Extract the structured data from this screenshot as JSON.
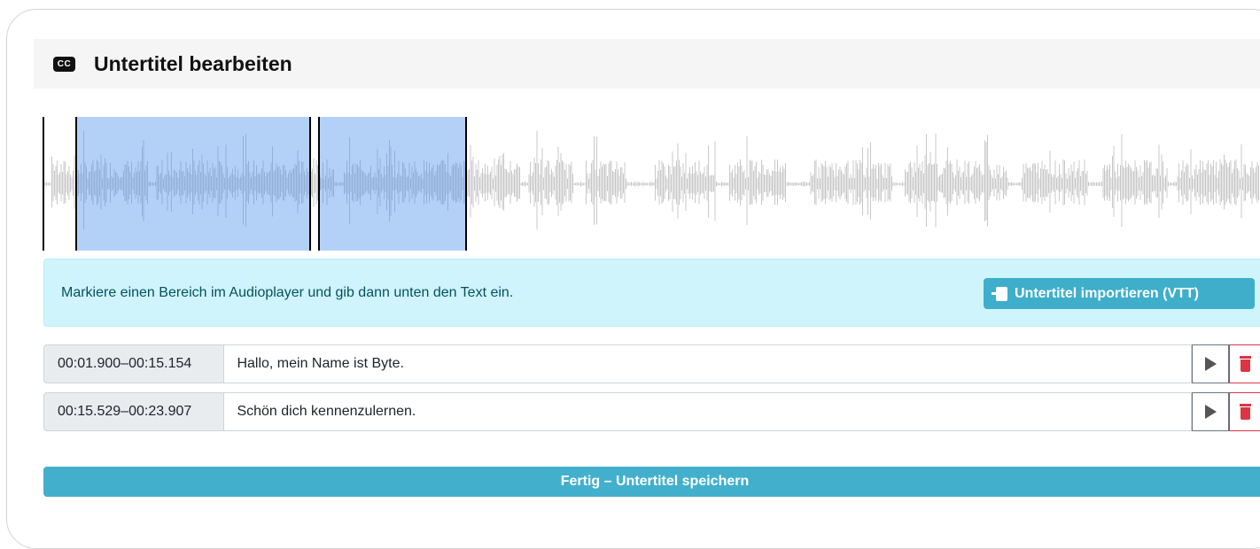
{
  "modal": {
    "icon": "cc-icon",
    "cc_text": "CC",
    "title": "Untertitel bearbeiten",
    "close_symbol": "×"
  },
  "waveform": {
    "wave_color": "#c8c8c8",
    "region_color": "#b3d1f7",
    "region_wave_color": "#93b0d8"
  },
  "info": {
    "text": "Markiere einen Bereich im Audioplayer und gib dann unten den Text ein.",
    "import_label": "Untertitel importieren (VTT)",
    "import_icon": "file-import-icon"
  },
  "subtitles": [
    {
      "time": "00:01.900–00:15.154",
      "text": "Hallo, mein Name ist Byte."
    },
    {
      "time": "00:15.529–00:23.907",
      "text": "Schön dich kennenzulernen."
    }
  ],
  "footer": {
    "save_label": "Fertig – Untertitel speichern"
  },
  "colors": {
    "accent": "#42b0cd",
    "info_bg": "#cff4fc",
    "danger": "#dc3545"
  }
}
